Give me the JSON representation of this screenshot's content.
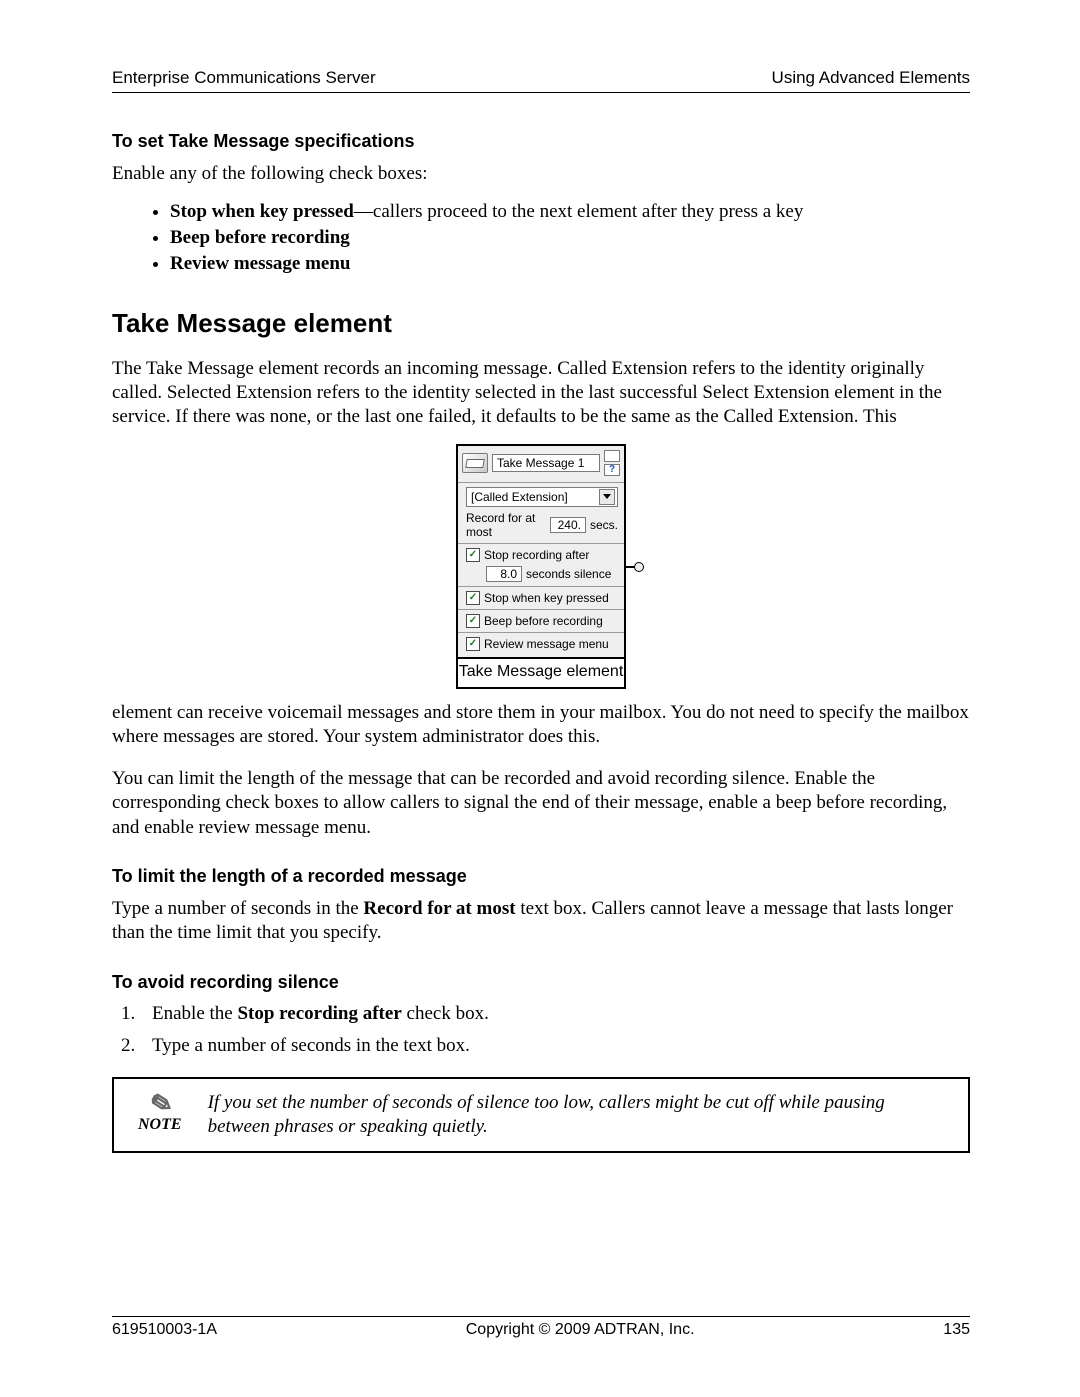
{
  "header": {
    "left": "Enterprise Communications Server",
    "right": "Using Advanced Elements"
  },
  "sub1": {
    "title": "To set Take Message specifications",
    "intro": "Enable any of the following check boxes:",
    "bullets": {
      "b1_bold": "Stop when key pressed",
      "b1_rest": "—callers proceed to the next element after they press a key",
      "b2_bold": "Beep before recording",
      "b3_bold": "Review message menu"
    }
  },
  "section": {
    "title": "Take Message element",
    "p1": "The Take Message element records an incoming message. Called Extension refers to the identity originally called. Selected Extension refers to the identity selected in the last successful Select Extension element in the service. If there was none, or the last one failed, it defaults to be the same as the Called Extension. This",
    "p2": "element can receive voicemail messages and store them in your mailbox. You do not need to specify the mailbox where messages are stored. Your system administrator does this.",
    "p3": "You can limit the length of the message that can be recorded and avoid recording silence. Enable the corresponding check boxes to allow callers to signal the end of their message, enable a beep before recording, and enable review message menu."
  },
  "figure": {
    "title": "Take Message 1",
    "help": "?",
    "select_value": "[Called Extension]",
    "row_record_pre": "Record for at most",
    "row_record_val": "240.",
    "row_record_post": "secs.",
    "chk_stop_label": "Stop recording after",
    "silence_val": "8.0",
    "silence_post": "seconds silence",
    "chk_key": "Stop when key pressed",
    "chk_beep": "Beep before recording",
    "chk_review": "Review message menu",
    "caption": "Take Message element"
  },
  "sub2": {
    "title": "To limit the length of a recorded message",
    "p_pre": "Type a number of seconds in the ",
    "p_bold": "Record for at most",
    "p_post": " text box. Callers cannot leave a message that lasts longer than the time limit that you specify."
  },
  "sub3": {
    "title": "To avoid recording silence",
    "s1_pre": "Enable the ",
    "s1_bold": "Stop recording after",
    "s1_post": " check box.",
    "s2": "Type a number of seconds in the text box."
  },
  "note": {
    "label": "NOTE",
    "text": "If you set the number of seconds of silence too low, callers might be cut off while pausing between phrases or speaking quietly."
  },
  "footer": {
    "left": "619510003-1A",
    "center": "Copyright © 2009 ADTRAN, Inc.",
    "right": "135"
  }
}
